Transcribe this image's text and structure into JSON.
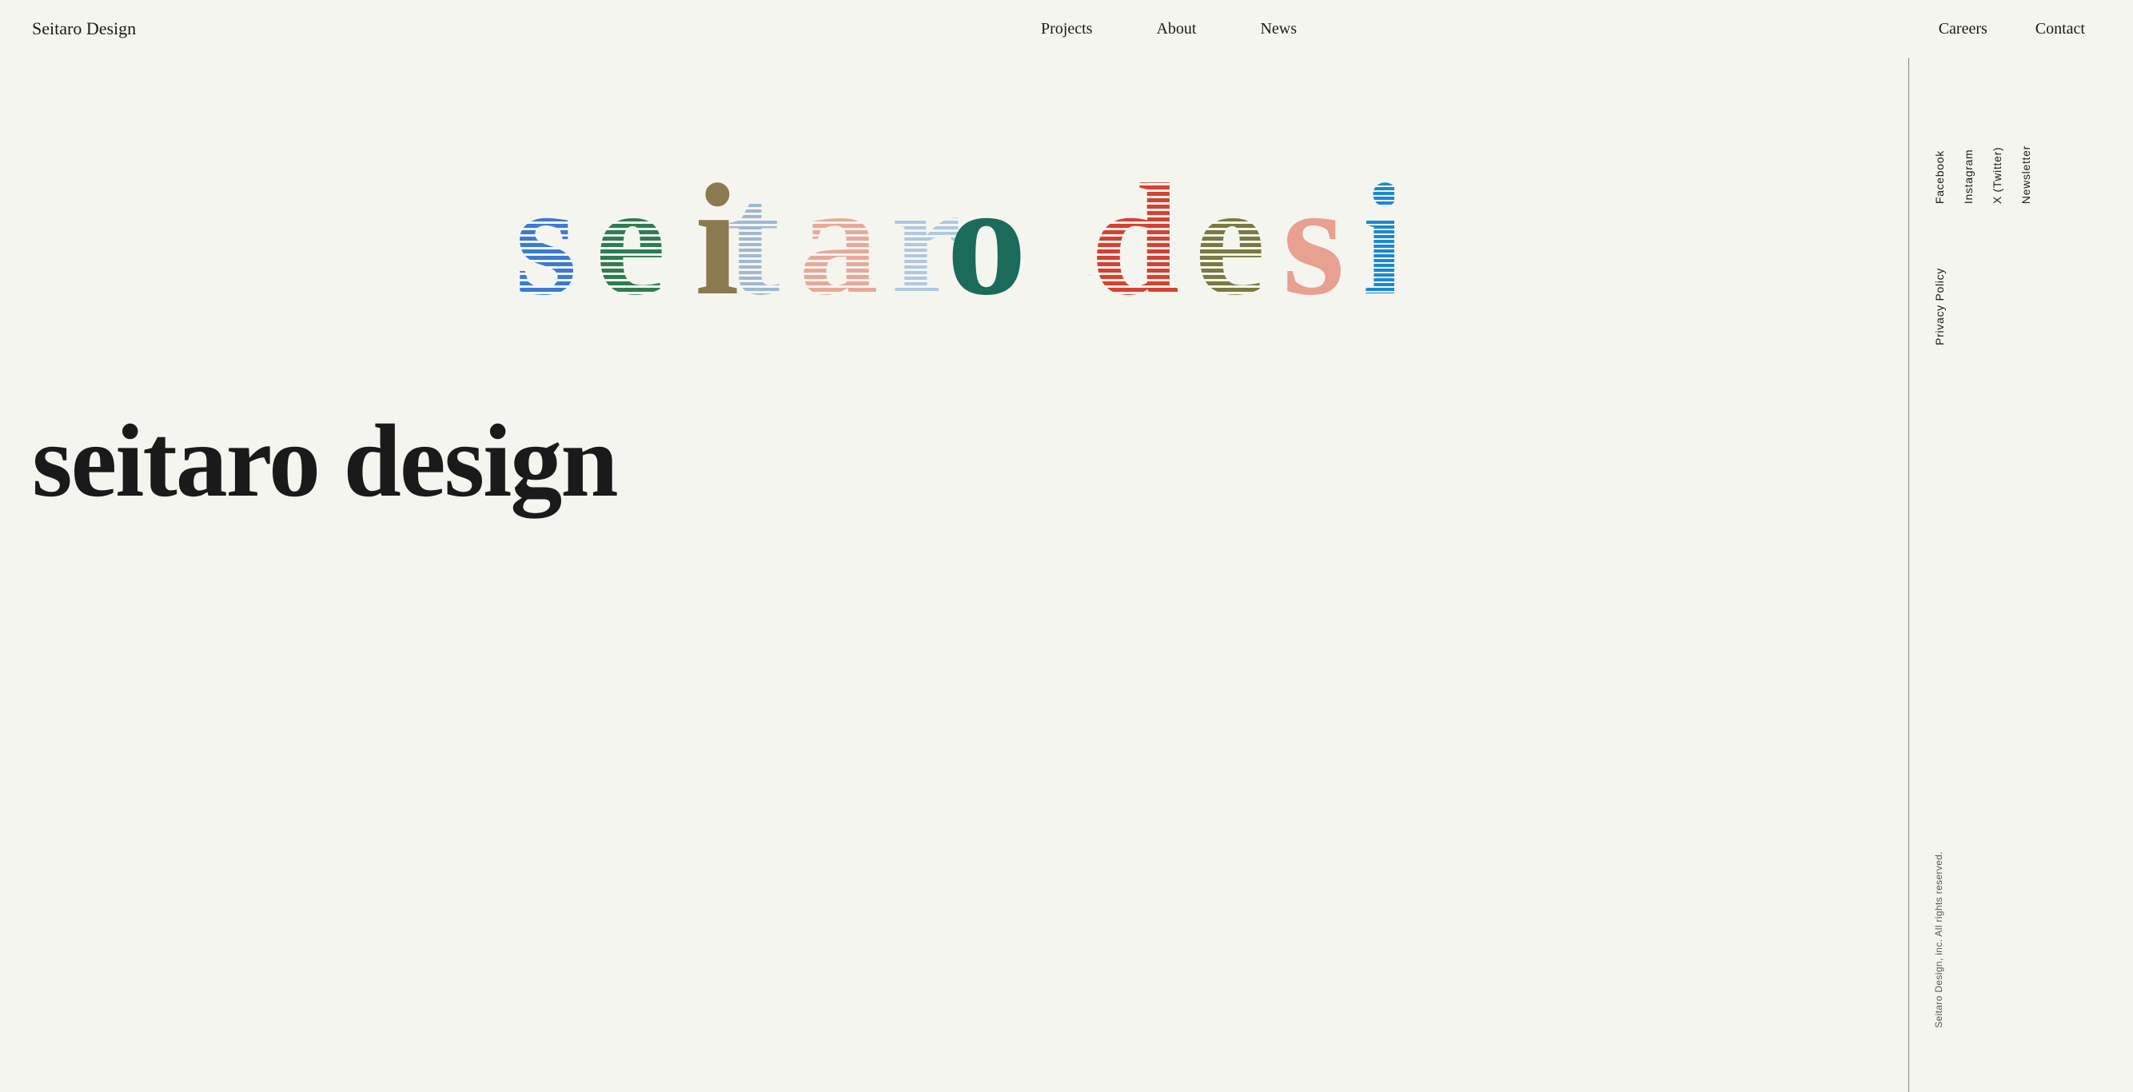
{
  "header": {
    "logo": "Seitaro Design",
    "nav_center": [
      {
        "label": "Projects",
        "href": "#"
      },
      {
        "label": "About",
        "href": "#"
      },
      {
        "label": "News",
        "href": "#"
      }
    ],
    "nav_right": [
      {
        "label": "Careers",
        "href": "#"
      },
      {
        "label": "Contact",
        "href": "#"
      }
    ]
  },
  "sidebar": {
    "social_links": [
      {
        "label": "Facebook"
      },
      {
        "label": "Instagram"
      },
      {
        "label": "X (Twitter)"
      },
      {
        "label": "Newsletter"
      }
    ],
    "policy": {
      "label": "Privacy Policy"
    },
    "copyright": {
      "label": "Seitaro Design, inc. All rights reserved."
    }
  },
  "main": {
    "big_title": "seitaro design"
  }
}
